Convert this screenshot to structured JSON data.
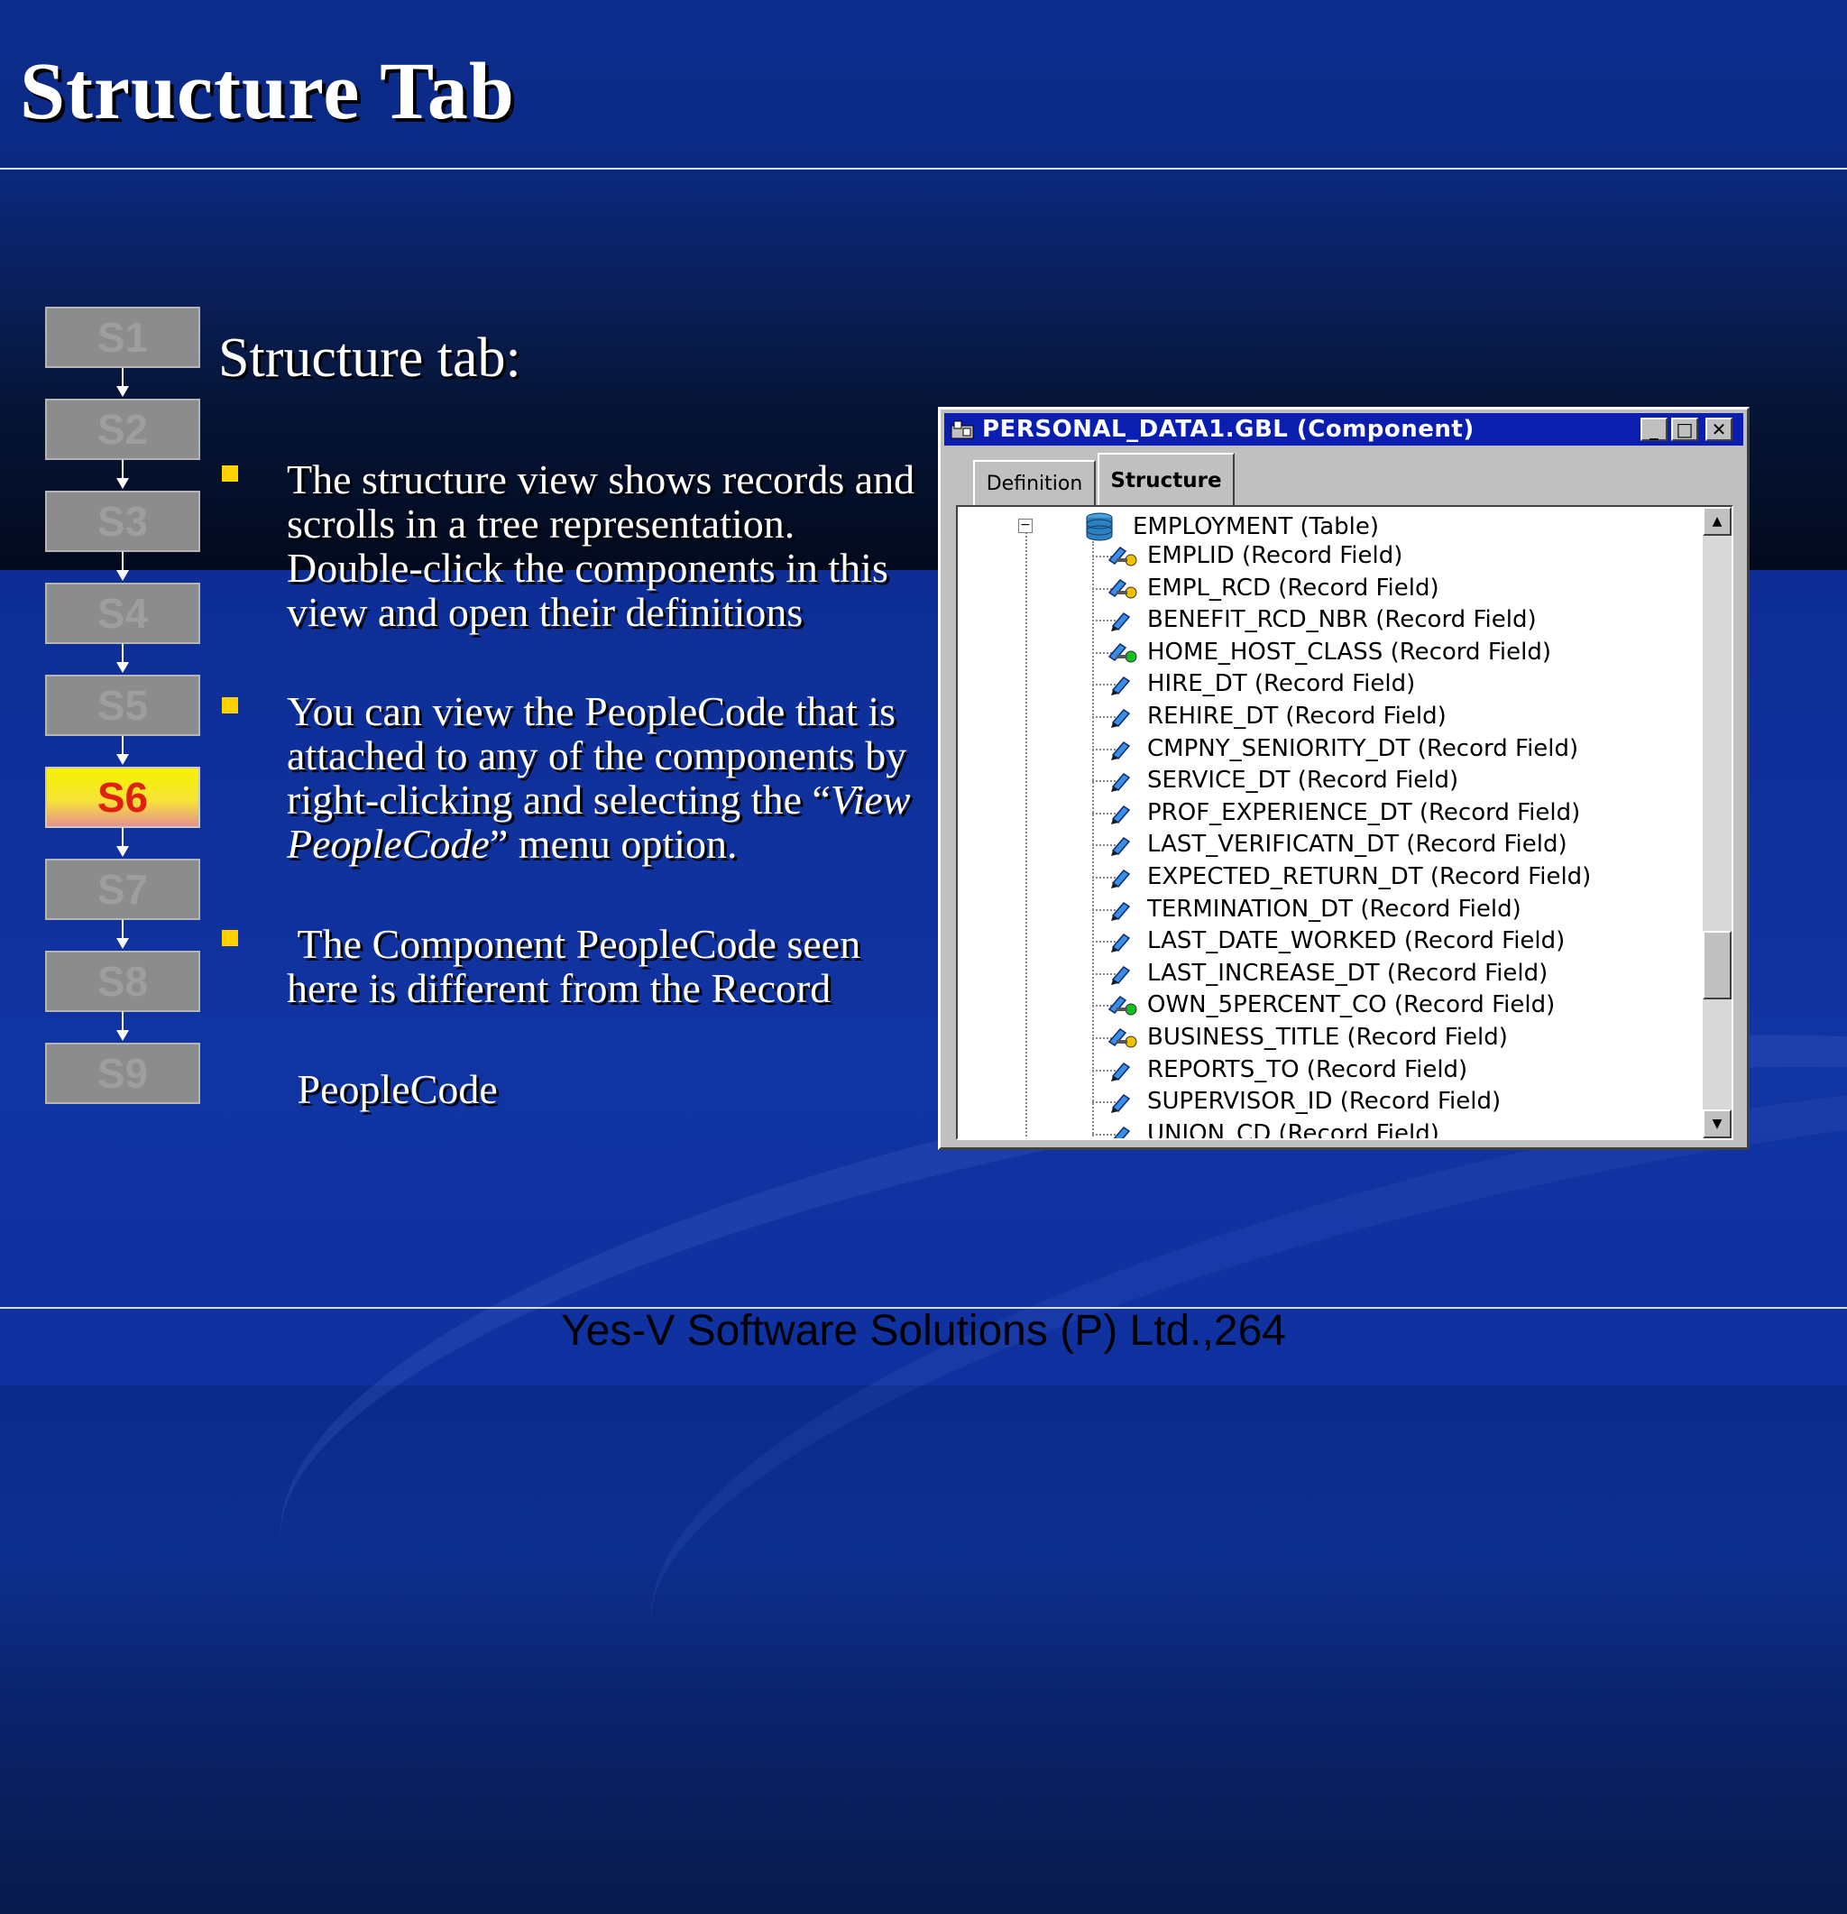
{
  "slide": {
    "title": "Structure Tab",
    "subheading": "Structure tab:",
    "bullets": [
      {
        "text": "The structure view shows records and scrolls in a tree representation. Double-click the components in this view and open their definitions"
      },
      {
        "text_before": "You can view the PeopleCode that is attached to any of the components by right-clicking and selecting the “",
        "text_italic": "View PeopleCode",
        "text_after": "” menu option."
      },
      {
        "line1": " The Component PeopleCode seen here is different from the Record",
        "line2": " PeopleCode"
      }
    ],
    "footer": "Yes-V Software Solutions (P) Ltd.,264",
    "colors": {
      "bullet": "#ffd200",
      "active_step_text": "#e02010",
      "window_titlebar": "#0a1eb0"
    }
  },
  "steps": {
    "items": [
      "S1",
      "S2",
      "S3",
      "S4",
      "S5",
      "S6",
      "S7",
      "S8",
      "S9"
    ],
    "active": "S6"
  },
  "window": {
    "title": "PERSONAL_DATA1.GBL (Component)",
    "controls": {
      "minimize": "_",
      "maximize": "□",
      "close": "✕"
    },
    "tabs": [
      {
        "label": "Definition",
        "active": false
      },
      {
        "label": "Structure",
        "active": true
      }
    ],
    "tree": {
      "root": {
        "label": "EMPLOYMENT (Table)",
        "icon": "database-icon",
        "expanded": true
      },
      "fields": [
        {
          "label": "EMPLID (Record Field)",
          "icon": "key-field-icon"
        },
        {
          "label": "EMPL_RCD (Record Field)",
          "icon": "key-field-icon"
        },
        {
          "label": "BENEFIT_RCD_NBR (Record Field)",
          "icon": "record-field-icon"
        },
        {
          "label": "HOME_HOST_CLASS (Record Field)",
          "icon": "key-field-green-icon"
        },
        {
          "label": "HIRE_DT (Record Field)",
          "icon": "record-field-icon"
        },
        {
          "label": "REHIRE_DT (Record Field)",
          "icon": "record-field-icon"
        },
        {
          "label": "CMPNY_SENIORITY_DT (Record Field)",
          "icon": "record-field-icon"
        },
        {
          "label": "SERVICE_DT (Record Field)",
          "icon": "record-field-icon"
        },
        {
          "label": "PROF_EXPERIENCE_DT (Record Field)",
          "icon": "record-field-icon"
        },
        {
          "label": "LAST_VERIFICATN_DT (Record Field)",
          "icon": "record-field-icon"
        },
        {
          "label": "EXPECTED_RETURN_DT (Record Field)",
          "icon": "record-field-icon"
        },
        {
          "label": "TERMINATION_DT (Record Field)",
          "icon": "record-field-icon"
        },
        {
          "label": "LAST_DATE_WORKED (Record Field)",
          "icon": "record-field-icon"
        },
        {
          "label": "LAST_INCREASE_DT (Record Field)",
          "icon": "record-field-icon"
        },
        {
          "label": "OWN_5PERCENT_CO (Record Field)",
          "icon": "key-field-green-icon"
        },
        {
          "label": "BUSINESS_TITLE (Record Field)",
          "icon": "key-field-icon"
        },
        {
          "label": "REPORTS_TO (Record Field)",
          "icon": "record-field-icon"
        },
        {
          "label": "SUPERVISOR_ID (Record Field)",
          "icon": "record-field-icon"
        },
        {
          "label": "UNION_CD (Record Field)",
          "icon": "record-field-icon"
        }
      ]
    }
  }
}
